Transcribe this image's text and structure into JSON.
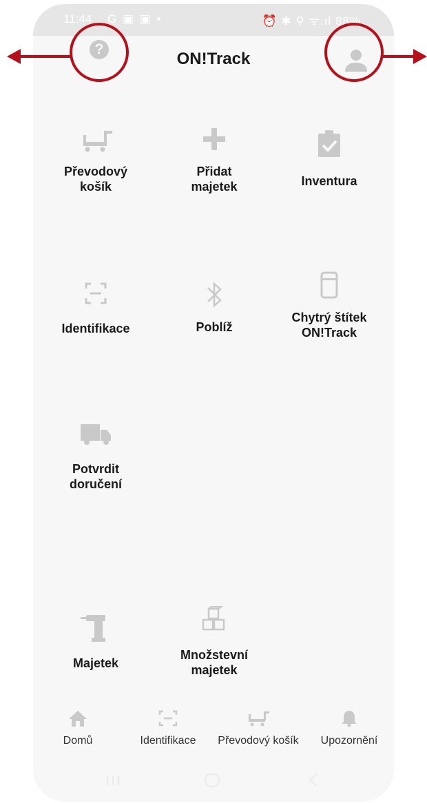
{
  "status_bar": {
    "time": "11:44",
    "notification_icons": "G ▣ ▣ •",
    "right_icons": "⏰ ✱ ⚲ ᯤ.ıl",
    "battery": "88%"
  },
  "header": {
    "title": "ON!Track",
    "help_icon": "question-circle-icon",
    "profile_icon": "person-icon"
  },
  "tiles": [
    {
      "label": "Převodový\nkošík",
      "icon": "cart-icon"
    },
    {
      "label": "Přidat\nmajetek",
      "icon": "plus-icon"
    },
    {
      "label": "Inventura",
      "icon": "clipboard-check-icon"
    },
    {
      "label": "Identifikace",
      "icon": "scan-icon"
    },
    {
      "label": "Poblíž",
      "icon": "bluetooth-icon"
    },
    {
      "label": "Chytrý štítek\nON!Track",
      "icon": "smart-tag-icon"
    },
    {
      "label": "Potvrdit\ndoručení",
      "icon": "truck-icon"
    },
    {
      "label": "Majetek",
      "icon": "drill-icon"
    },
    {
      "label": "Množstevní\nmajetek",
      "icon": "boxes-icon"
    }
  ],
  "bottom_nav": [
    {
      "label": "Domů",
      "icon": "home-icon"
    },
    {
      "label": "Identifikace",
      "icon": "scan-icon"
    },
    {
      "label": "Převodový košík",
      "icon": "cart-icon"
    },
    {
      "label": "Upozornění",
      "icon": "bell-icon"
    }
  ],
  "colors": {
    "annotation": "#b3121d",
    "icon_gray": "#c9c9c9",
    "background": "#f7f7f7"
  }
}
